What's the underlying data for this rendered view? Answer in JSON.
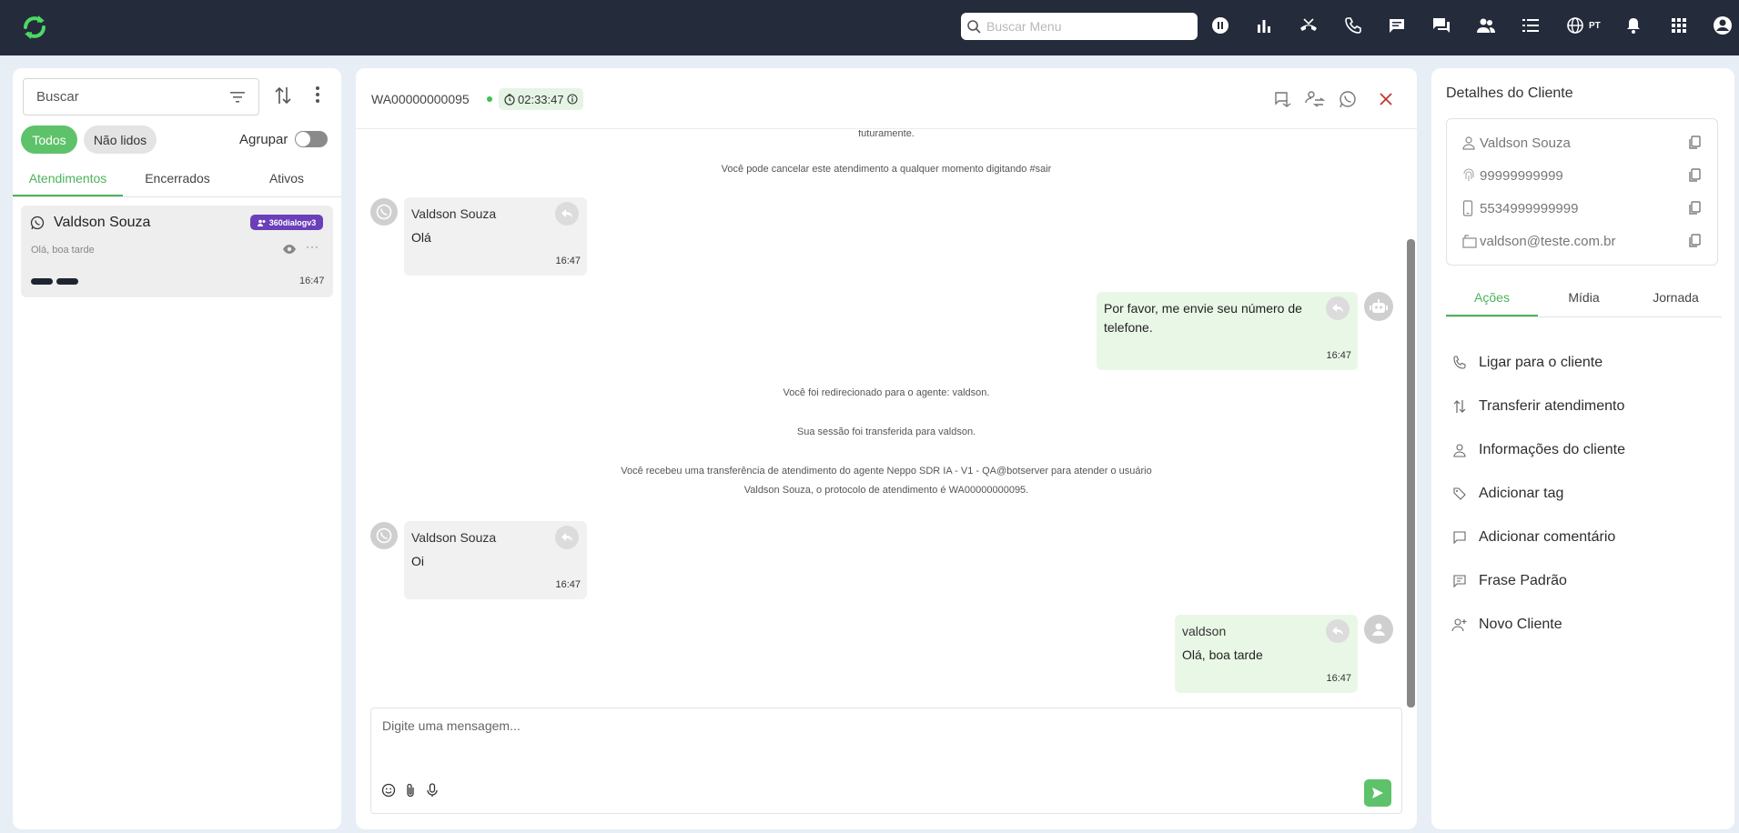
{
  "topbar": {
    "search_placeholder": "Buscar Menu",
    "language": "PT",
    "icons": [
      "pause-icon",
      "bar-chart-icon",
      "call-end-icon",
      "phone-icon",
      "chat-icon",
      "forum-icon",
      "group-icon",
      "list-icon",
      "globe-icon",
      "bell-icon",
      "apps-icon",
      "user-icon"
    ]
  },
  "left": {
    "search_placeholder": "Buscar",
    "filters": {
      "all": "Todos",
      "unread": "Não lidos"
    },
    "group_label": "Agrupar",
    "tabs": [
      "Atendimentos",
      "Encerrados",
      "Ativos"
    ],
    "conversations": [
      {
        "name": "Valdson Souza",
        "badge": "360dialogv3",
        "preview": "Olá, boa tarde",
        "time": "16:47"
      }
    ]
  },
  "chat": {
    "protocol": "WA00000000095",
    "timer": "02:33:47",
    "system_top_partial": "futuramente.",
    "system_cancel": "Você pode cancelar este atendimento a qualquer momento digitando #sair",
    "system_redirect": "Você foi redirecionado para o agente: valdson.",
    "system_session": "Sua sessão foi transferida para valdson.",
    "system_transfer_line1": "Você recebeu uma transferência de atendimento do agente Neppo SDR IA - V1 - QA@botserver para atender o usuário",
    "system_transfer_line2": "Valdson Souza, o protocolo de atendimento é WA00000000095.",
    "messages": [
      {
        "sender": "Valdson Souza",
        "text": "Olá",
        "time": "16:47"
      },
      {
        "text_line1": "Por favor, me envie seu número de",
        "text_line2": "telefone.",
        "time": "16:47"
      },
      {
        "sender": "Valdson Souza",
        "text": "Oi",
        "time": "16:47"
      },
      {
        "sender": "valdson",
        "text": "Olá, boa tarde",
        "time": "16:47"
      }
    ],
    "composer_placeholder": "Digite uma mensagem..."
  },
  "right": {
    "title": "Detalhes do Cliente",
    "client": {
      "name": "Valdson Souza",
      "document": "99999999999",
      "phone": "5534999999999",
      "email": "valdson@teste.com.br"
    },
    "tabs": [
      "Ações",
      "Mídia",
      "Jornada"
    ],
    "actions": [
      "Ligar para o cliente",
      "Transferir atendimento",
      "Informações do cliente",
      "Adicionar tag",
      "Adicionar comentário",
      "Frase Padrão",
      "Novo Cliente"
    ]
  },
  "colors": {
    "topbar": "#242b3b",
    "accent_green": "#5ec26a",
    "badge_purple": "#6a3fba",
    "bubble_out": "#e9f8e6",
    "bubble_in": "#f1f1f1"
  }
}
